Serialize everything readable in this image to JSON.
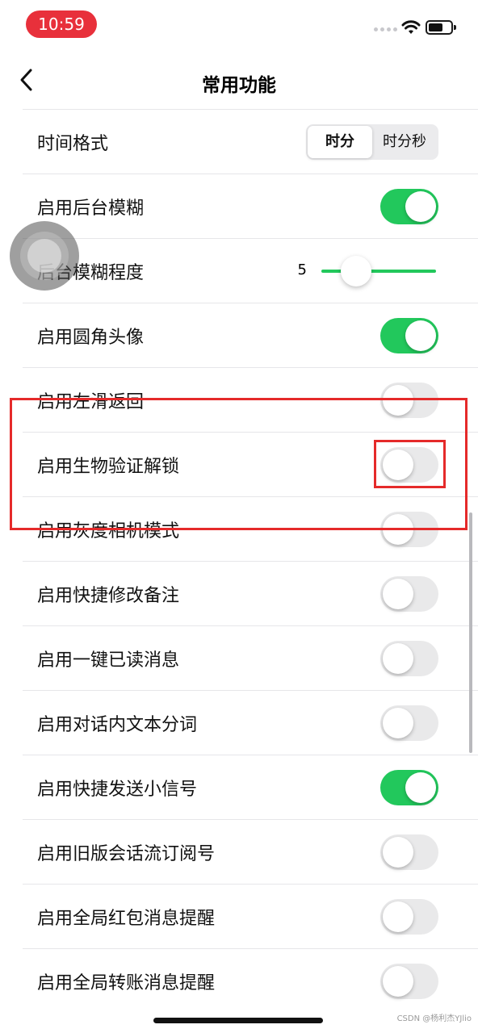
{
  "status_bar": {
    "time": "10:59"
  },
  "nav": {
    "title": "常用功能"
  },
  "time_format": {
    "label": "时间格式",
    "options": [
      "时分",
      "时分秒"
    ],
    "selected": "时分"
  },
  "rows": [
    {
      "label": "启用后台模糊",
      "on": true
    },
    {
      "label": "后台模糊程度",
      "slider_value": "5"
    },
    {
      "label": "启用圆角头像",
      "on": true
    },
    {
      "label": "启用左滑返回",
      "on": false
    },
    {
      "label": "启用生物验证解锁",
      "on": false
    },
    {
      "label": "启用灰度相机模式",
      "on": false
    },
    {
      "label": "启用快捷修改备注",
      "on": false
    },
    {
      "label": "启用一键已读消息",
      "on": false
    },
    {
      "label": "启用对话内文本分词",
      "on": false
    },
    {
      "label": "启用快捷发送小信号",
      "on": true
    },
    {
      "label": "启用旧版会话流订阅号",
      "on": false
    },
    {
      "label": "启用全局红包消息提醒",
      "on": false
    },
    {
      "label": "启用全局转账消息提醒",
      "on": false
    }
  ],
  "colors": {
    "toggle_on": "#22c85c",
    "highlight": "#e52a2a"
  },
  "watermark": "CSDN @杨利杰YJlio"
}
